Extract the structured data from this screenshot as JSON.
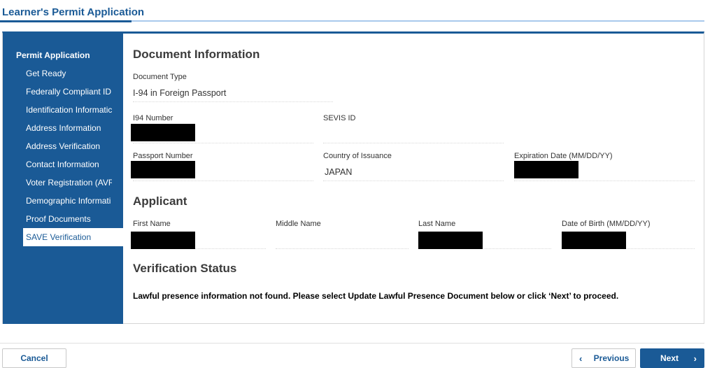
{
  "app": {
    "title": "Learner's Permit Application"
  },
  "sidebar": {
    "heading": "Permit Application",
    "items": [
      {
        "label": "Get Ready"
      },
      {
        "label": "Federally Compliant ID"
      },
      {
        "label": "Identification Informatic"
      },
      {
        "label": "Address Information"
      },
      {
        "label": "Address Verification"
      },
      {
        "label": "Contact Information"
      },
      {
        "label": "Voter Registration (AVR"
      },
      {
        "label": "Demographic Informati"
      },
      {
        "label": "Proof Documents"
      },
      {
        "label": "SAVE Verification"
      }
    ],
    "active_index": 9
  },
  "document": {
    "title": "Document Information",
    "type_label": "Document Type",
    "type_value": "I-94 in Foreign Passport",
    "i94_label": "I94 Number",
    "sevis_label": "SEVIS ID",
    "passport_label": "Passport Number",
    "country_label": "Country of Issuance",
    "country_value": "JAPAN",
    "expiration_label": "Expiration Date (MM/DD/YY)"
  },
  "applicant": {
    "title": "Applicant",
    "first_label": "First Name",
    "middle_label": "Middle Name",
    "last_label": "Last Name",
    "dob_label": "Date of Birth (MM/DD/YY)"
  },
  "verification": {
    "title": "Verification Status",
    "message": "Lawful presence information not found. Please select Update Lawful Presence Document below or click ‘Next’ to proceed."
  },
  "buttons": {
    "cancel": "Cancel",
    "previous": "Previous",
    "next": "Next"
  },
  "icons": {
    "prev": "chevron-left-icon",
    "next": "chevron-right-icon"
  },
  "colors": {
    "brand": "#1a5a96",
    "redaction": "#000000"
  }
}
